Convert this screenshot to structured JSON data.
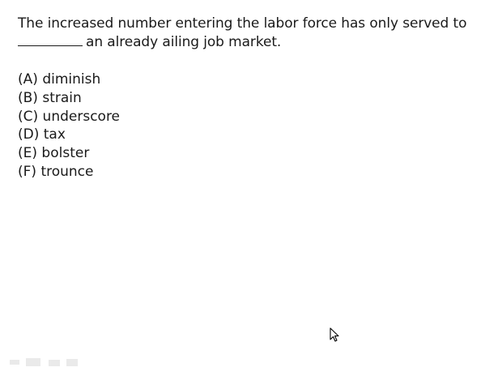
{
  "question": {
    "line1": "The increased number entering the labor force has only served to",
    "line2_rest": "an already ailing job market."
  },
  "options": [
    {
      "letter": "(A)",
      "text": "diminish"
    },
    {
      "letter": "(B)",
      "text": "strain"
    },
    {
      "letter": "(C)",
      "text": "underscore"
    },
    {
      "letter": "(D)",
      "text": "tax"
    },
    {
      "letter": "(E)",
      "text": "bolster"
    },
    {
      "letter": "(F)",
      "text": "trounce"
    }
  ],
  "colors": {
    "text": "#1a1a1a",
    "background": "#ffffff"
  },
  "icons": {
    "cursor": "mouse-pointer-icon"
  }
}
